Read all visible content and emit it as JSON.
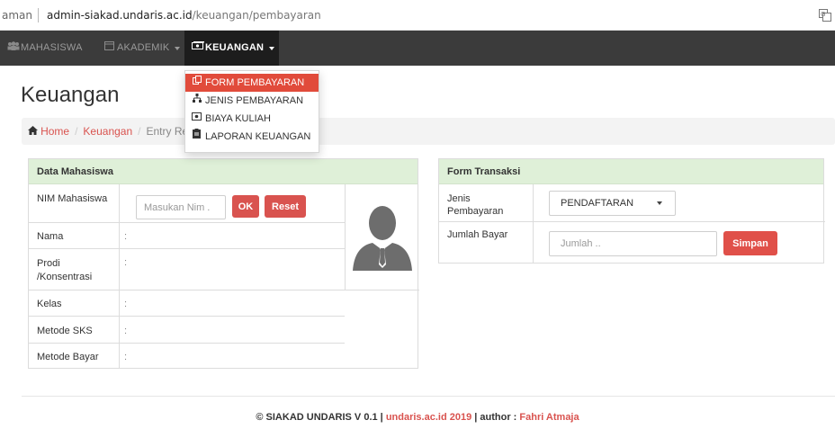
{
  "browser": {
    "security_label": "aman",
    "url_host": "admin-siakad.undaris.ac.id",
    "url_path": "/keuangan/pembayaran"
  },
  "nav": {
    "items": [
      {
        "label": "MAHASISWA",
        "icon": "users-icon"
      },
      {
        "label": "AKADEMIK",
        "icon": "calendar-icon"
      },
      {
        "label": "KEUANGAN",
        "icon": "money-icon"
      }
    ]
  },
  "dropdown": {
    "items": [
      {
        "label": "FORM PEMBAYARAN",
        "icon": "copy-icon"
      },
      {
        "label": "JENIS PEMBAYARAN",
        "icon": "sitemap-icon"
      },
      {
        "label": "BIAYA KULIAH",
        "icon": "money-icon"
      },
      {
        "label": "LAPORAN KEUANGAN",
        "icon": "clipboard-icon"
      }
    ]
  },
  "page": {
    "title": "Keuangan"
  },
  "breadcrumb": {
    "home": "Home",
    "section": "Keuangan",
    "current": "Entry Re"
  },
  "mahasiswa_panel": {
    "title": "Data Mahasiswa",
    "nim_label": "NIM Mahasiswa",
    "nim_placeholder": "Masukan Nim .",
    "ok_label": "OK",
    "reset_label": "Reset",
    "rows": [
      {
        "label": "Nama",
        "value": ":"
      },
      {
        "label": "Prodi /Konsentrasi",
        "value": ":"
      },
      {
        "label": "Kelas",
        "value": ":"
      },
      {
        "label": "Metode SKS",
        "value": ":"
      },
      {
        "label": "Metode Bayar",
        "value": ":"
      }
    ]
  },
  "transaksi_panel": {
    "title": "Form Transaksi",
    "jenis_label": "Jenis Pembayaran",
    "jenis_selected": "PENDAFTARAN",
    "jumlah_label": "Jumlah Bayar",
    "jumlah_placeholder": "Jumlah ..",
    "simpan_label": "Simpan"
  },
  "footer": {
    "prefix": "© SIAKAD UNDARIS V 0.1 | ",
    "site": "undaris.ac.id 2019",
    "middle": " | author : ",
    "author": "Fahri Atmaja"
  },
  "colors": {
    "accent": "#d9534f",
    "navbar": "#3b3b3b",
    "panel_head": "#dff0d8"
  }
}
